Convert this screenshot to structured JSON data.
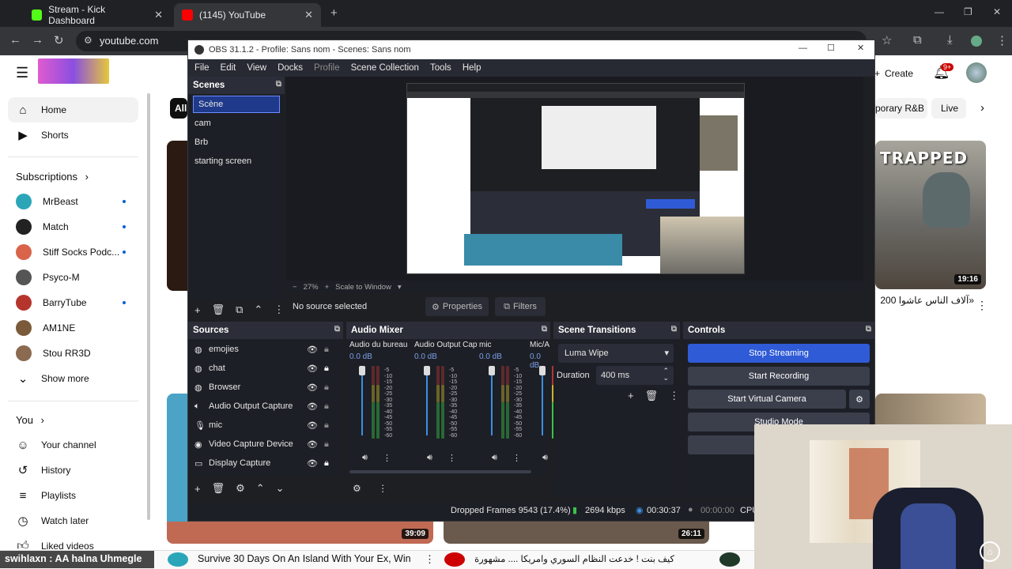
{
  "browser": {
    "tabs": [
      {
        "label": "Stream - Kick Dashboard",
        "color": "#53fc18"
      },
      {
        "label": "(1145) YouTube",
        "color": "#ff0000"
      }
    ],
    "url": "youtube.com"
  },
  "youtube": {
    "sidebar": {
      "top": [
        {
          "label": "Home",
          "icon": "home-icon"
        },
        {
          "label": "Shorts",
          "icon": "shorts-icon"
        }
      ],
      "subscriptions_header": "Subscriptions",
      "subscriptions": [
        {
          "label": "MrBeast",
          "color": "#2aa6b8",
          "dot": true
        },
        {
          "label": "Match",
          "color": "#222222",
          "dot": true
        },
        {
          "label": "Stiff Socks Podc...",
          "color": "#d9644a",
          "dot": true
        },
        {
          "label": "Psyco-M",
          "color": "#555555",
          "dot": false
        },
        {
          "label": "BarryTube",
          "color": "#b5352c",
          "dot": true
        },
        {
          "label": "AM1NE",
          "color": "#7a5a3a",
          "dot": false
        },
        {
          "label": "Stou RR3D",
          "color": "#8a6a50",
          "dot": false
        }
      ],
      "show_more": "Show more",
      "you_header": "You",
      "you_items": [
        {
          "label": "Your channel",
          "icon": "person-icon"
        },
        {
          "label": "History",
          "icon": "history-icon"
        },
        {
          "label": "Playlists",
          "icon": "playlist-icon"
        },
        {
          "label": "Watch later",
          "icon": "clock-icon"
        },
        {
          "label": "Liked videos",
          "icon": "thumb-icon"
        }
      ]
    },
    "header": {
      "create": "Create",
      "notif_badge": "9+"
    },
    "chips": {
      "all": "All",
      "porary": "porary R&B",
      "live": "Live"
    },
    "videos": [
      {
        "duration": "19:16",
        "title": "«آلاف الناس عاشوا ‏200"
      },
      {
        "duration": "39:09"
      },
      {
        "duration": "26:11"
      }
    ],
    "bottom_titles": [
      "Survive 30 Days On An Island With Your Ex, Win",
      "كيف بنت ! خدعت النظام السوري وامريكا .... مشهورة فيسبوك"
    ]
  },
  "overlay_chat": "swihlaxn : AA halna Uhmegle",
  "obs": {
    "title": "OBS 31.1.2 - Profile: Sans nom - Scenes: Sans nom",
    "menu": [
      "File",
      "Edit",
      "View",
      "Docks",
      "Profile",
      "Scene Collection",
      "Tools",
      "Help"
    ],
    "scenes_header": "Scenes",
    "scenes": [
      "Scène",
      "cam",
      "Brb",
      "starting screen"
    ],
    "zoom": "27%",
    "scale_label": "Scale to Window",
    "no_source": "No source selected",
    "properties": "Properties",
    "filters": "Filters",
    "sources_header": "Sources",
    "sources": [
      {
        "label": "emojies",
        "icon": "image-icon"
      },
      {
        "label": "chat",
        "icon": "browser-icon"
      },
      {
        "label": "Browser",
        "icon": "browser-icon"
      },
      {
        "label": "Audio Output Capture",
        "icon": "speaker-icon"
      },
      {
        "label": "mic",
        "icon": "mic-icon"
      },
      {
        "label": "Video Capture Device",
        "icon": "camera-icon"
      },
      {
        "label": "Display Capture",
        "icon": "monitor-icon"
      }
    ],
    "mixer_header": "Audio Mixer",
    "mixer_channels": [
      {
        "name": "Audio du bureau",
        "db": "0.0 dB"
      },
      {
        "name": "Audio Output Capt",
        "db": "0.0 dB"
      },
      {
        "name": "mic",
        "db": "0.0 dB"
      },
      {
        "name": "Mic/A",
        "db": "0.0 dB"
      }
    ],
    "meter_scale": [
      "-5",
      "-10",
      "-15",
      "-20",
      "-25",
      "-30",
      "-35",
      "-40",
      "-45",
      "-50",
      "-55",
      "-60"
    ],
    "transitions_header": "Scene Transitions",
    "transition": "Luma Wipe",
    "duration_label": "Duration",
    "duration_value": "400 ms",
    "controls_header": "Controls",
    "controls": {
      "stop_streaming": "Stop Streaming",
      "start_recording": "Start Recording",
      "start_virtual_camera": "Start Virtual Camera",
      "studio_mode": "Studio Mode"
    },
    "status": {
      "dropped": "Dropped Frames 9543 (17.4%)",
      "kbps": "2694 kbps",
      "stream_time": "00:30:37",
      "rec_time": "00:00:00",
      "cpu": "CPU"
    }
  }
}
